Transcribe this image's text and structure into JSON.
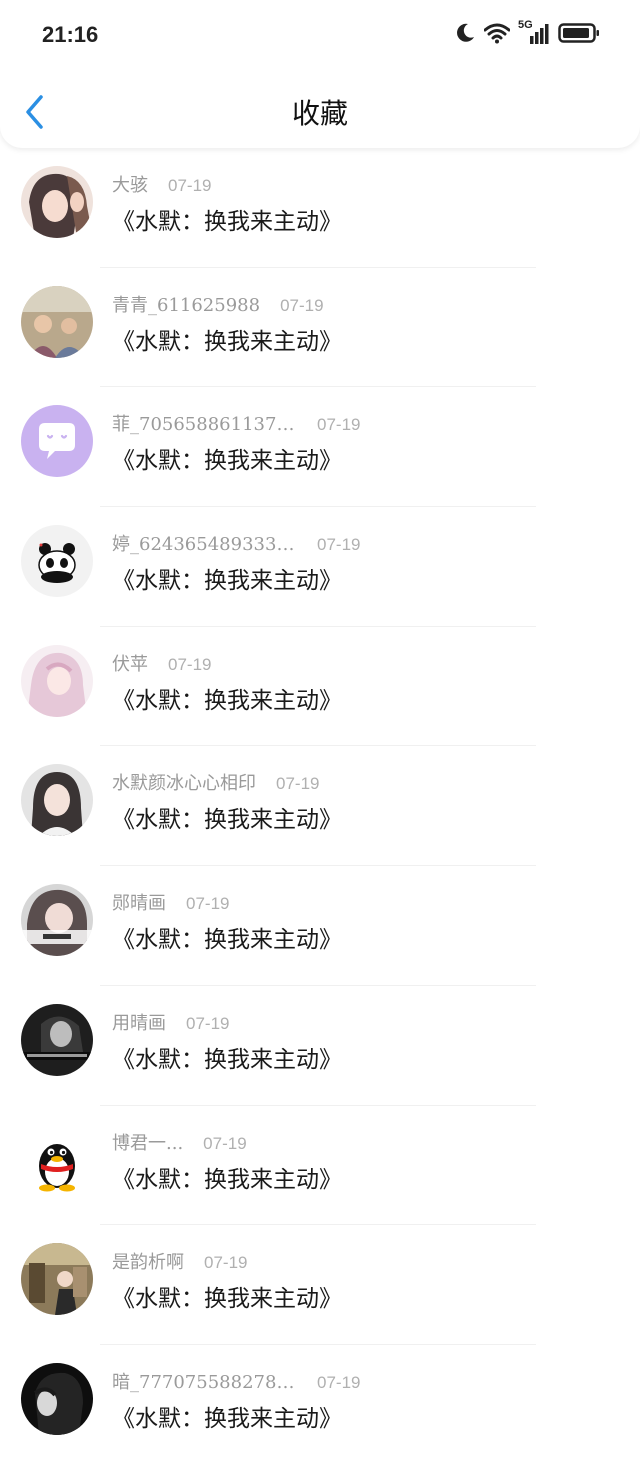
{
  "status_bar": {
    "time": "21:16",
    "network": "5G"
  },
  "nav": {
    "title": "收藏"
  },
  "colors": {
    "accent": "#2b8fe3",
    "name_gray": "#9a9a9a",
    "date_gray": "#b0b0b0"
  },
  "items": [
    {
      "name": "大骇",
      "date": "07-19",
      "title": "《水默：换我来主动》",
      "avatar": "anime-girl-avatar"
    },
    {
      "name": "青青_611625988",
      "date": "07-19",
      "title": "《水默：换我来主动》",
      "avatar": "group-photo-avatar"
    },
    {
      "name": "菲_7056588611378...",
      "date": "07-19",
      "title": "《水默：换我来主动》",
      "avatar": "chat-bubble-avatar"
    },
    {
      "name": "婷_6243654893333...",
      "date": "07-19",
      "title": "《水默：换我来主动》",
      "avatar": "panda-avatar"
    },
    {
      "name": "伏苹",
      "date": "07-19",
      "title": "《水默：换我来主动》",
      "avatar": "pink-hair-avatar"
    },
    {
      "name": "水默颜冰心心相印",
      "date": "07-19",
      "title": "《水默：换我来主动》",
      "avatar": "portrait-girl-avatar"
    },
    {
      "name": "郧晴画",
      "date": "07-19",
      "title": "《水默：换我来主动》",
      "avatar": "girl-with-caption-avatar"
    },
    {
      "name": "用晴画",
      "date": "07-19",
      "title": "《水默：换我来主动》",
      "avatar": "bw-girl-avatar"
    },
    {
      "name": "博君一...",
      "date": "07-19",
      "title": "《水默：换我来主动》",
      "avatar": "qq-penguin-avatar"
    },
    {
      "name": "是韵析啊",
      "date": "07-19",
      "title": "《水默：换我来主动》",
      "avatar": "outdoor-photo-avatar"
    },
    {
      "name": "暗_7770755882780...",
      "date": "07-19",
      "title": "《水默：换我来主动》",
      "avatar": "dark-portrait-avatar"
    }
  ]
}
